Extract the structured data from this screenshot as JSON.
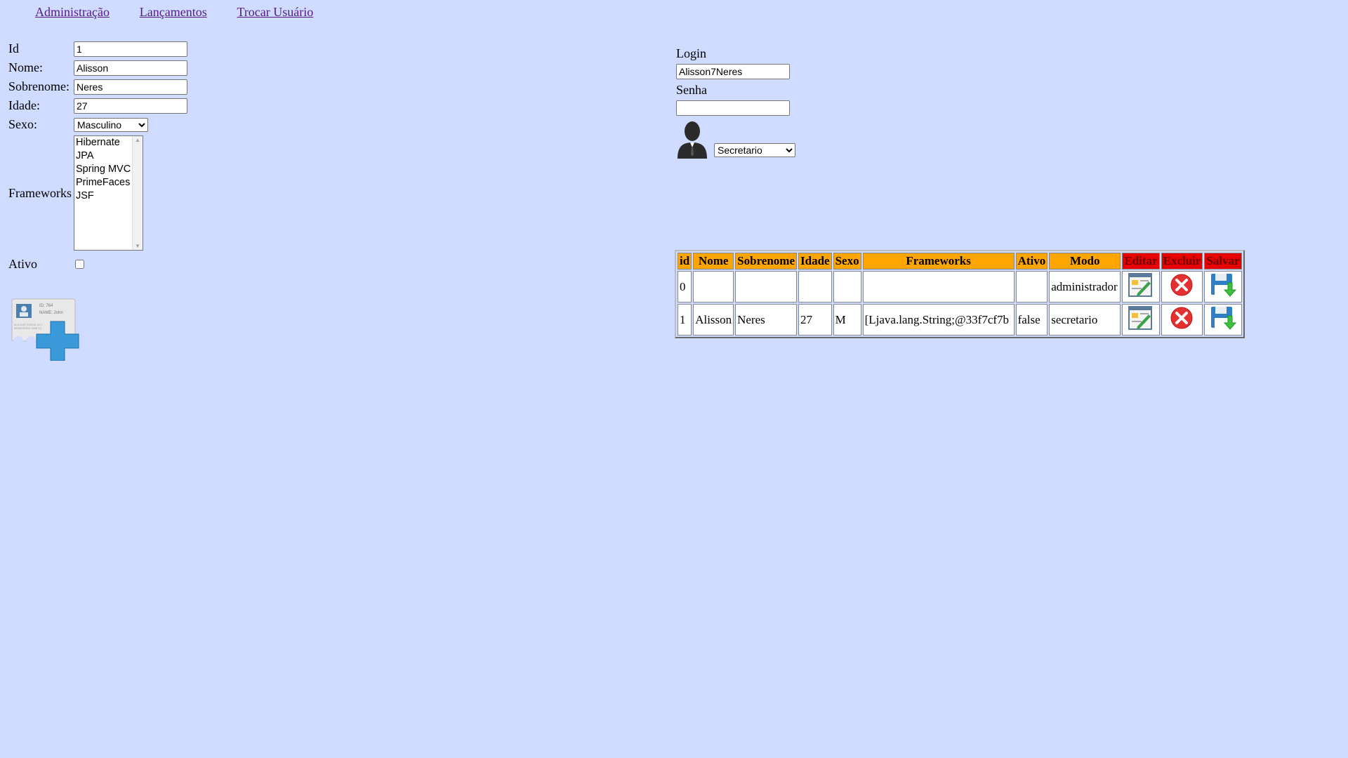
{
  "nav": {
    "links": [
      "Administração",
      "Lançamentos",
      "Trocar Usuário"
    ]
  },
  "form": {
    "id_label": "Id",
    "id_value": "1",
    "nome_label": "Nome:",
    "nome_value": "Alisson",
    "sobrenome_label": "Sobrenome:",
    "sobrenome_value": "Neres",
    "idade_label": "Idade:",
    "idade_value": "27",
    "sexo_label": "Sexo:",
    "sexo_selected": "Masculino",
    "frameworks_label": "Frameworks",
    "frameworks_options": [
      "Hibernate",
      "JPA",
      "Spring MVC",
      "PrimeFaces",
      "JSF"
    ],
    "ativo_label": "Ativo",
    "ativo_checked": false,
    "add_card_text": {
      "id": "ID: 764",
      "name": "NAME: John",
      "status": "ACCOUNT STATUS: ACT",
      "reg": "REGISTERED: JUNE 12"
    }
  },
  "login": {
    "login_label": "Login",
    "login_value": "Alisson7Neres",
    "senha_label": "Senha",
    "senha_value": "",
    "role_selected": "Secretario"
  },
  "table": {
    "headers": [
      "id",
      "Nome",
      "Sobrenome",
      "Idade",
      "Sexo",
      "Frameworks",
      "Ativo",
      "Modo",
      "Editar",
      "Excluir",
      "Salvar"
    ],
    "rows": [
      {
        "id": "0",
        "nome": "",
        "sobrenome": "",
        "idade": "",
        "sexo": "",
        "frameworks": "",
        "ativo": "",
        "modo": "administrador"
      },
      {
        "id": "1",
        "nome": "Alisson",
        "sobrenome": "Neres",
        "idade": "27",
        "sexo": "M",
        "frameworks": "[Ljava.lang.String;@33f7cf7b",
        "ativo": "false",
        "modo": "secretario"
      }
    ]
  },
  "colors": {
    "background": "#cfdcff",
    "header_orange": "#ffa500",
    "header_red": "#e80000",
    "link": "#551a8b"
  }
}
